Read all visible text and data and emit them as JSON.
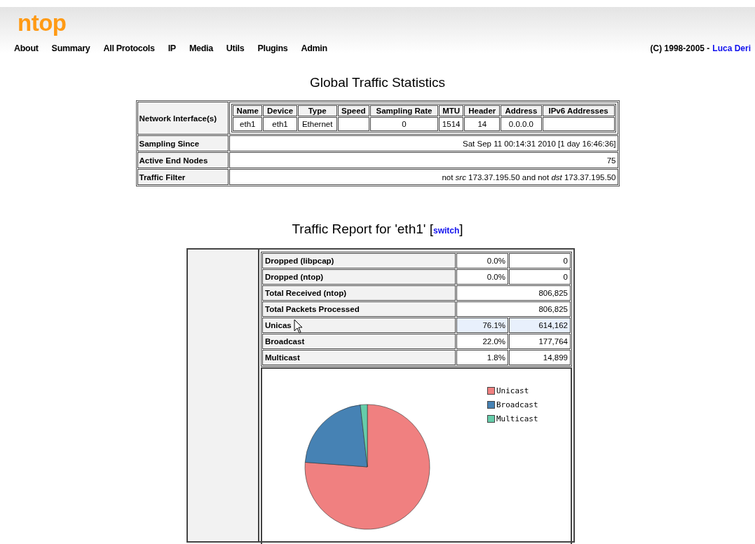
{
  "header": {
    "logo": "ntop",
    "menu": [
      {
        "label": "About"
      },
      {
        "label": "Summary"
      },
      {
        "label": "All Protocols"
      },
      {
        "label": "IP"
      },
      {
        "label": "Media"
      },
      {
        "label": "Utils"
      },
      {
        "label": "Plugins"
      },
      {
        "label": "Admin"
      }
    ],
    "copyright": "(C) 1998-2005 -",
    "author_link": "Luca Deri"
  },
  "global_stats": {
    "title": "Global Traffic Statistics",
    "interfaces_label": "Network Interface(s)",
    "interface_columns": [
      "Name",
      "Device",
      "Type",
      "Speed",
      "Sampling Rate",
      "MTU",
      "Header",
      "Address",
      "IPv6 Addresses"
    ],
    "interface_rows": [
      [
        "eth1",
        "eth1",
        "Ethernet",
        "",
        "0",
        "1514",
        "14",
        "0.0.0.0",
        ""
      ]
    ],
    "rows": [
      {
        "label": "Sampling Since",
        "value": "Sat Sep 11 00:14:31 2010 [1 day 16:46:36]"
      },
      {
        "label": "Active End Nodes",
        "value": "75"
      },
      {
        "label": "Traffic Filter",
        "value": "not *src* 173.37.195.50 and not *dst* 173.37.195.50"
      }
    ]
  },
  "traffic_report": {
    "title": "Traffic Report for 'eth1' [",
    "switch_link": "switch",
    "title_end": "]",
    "rows": [
      {
        "kind": "split",
        "label": "Dropped (libpcap)",
        "percent": "0.0%",
        "count": "0",
        "highlighted": false
      },
      {
        "kind": "split",
        "label": "Dropped (ntop)",
        "percent": "0.0%",
        "count": "0",
        "highlighted": false
      },
      {
        "kind": "total",
        "label": "Total Received (ntop)",
        "count": "806,825",
        "highlighted": false
      },
      {
        "kind": "total",
        "label": "Total Packets Processed",
        "count": "806,825",
        "highlighted": false
      },
      {
        "kind": "split",
        "label": "Unicas",
        "percent": "76.1%",
        "count": "614,162",
        "highlighted": true,
        "pointer": true
      },
      {
        "kind": "split",
        "label": "Broadcast",
        "percent": "22.0%",
        "count": "177,764",
        "highlighted": false
      },
      {
        "kind": "split",
        "label": "Multicast",
        "percent": "1.8%",
        "count": "14,899",
        "highlighted": false
      }
    ],
    "slice_colors": [
      {
        "color": "#f08080"
      },
      {
        "color": "#4682b4"
      },
      {
        "color": "#66cdaa"
      }
    ],
    "chart_data": {
      "type": "pie",
      "legend": "top-right",
      "categories": [
        "Unicast",
        "Broadcast",
        "Multicast"
      ],
      "values": [
        76.1,
        22.0,
        1.8
      ]
    }
  }
}
